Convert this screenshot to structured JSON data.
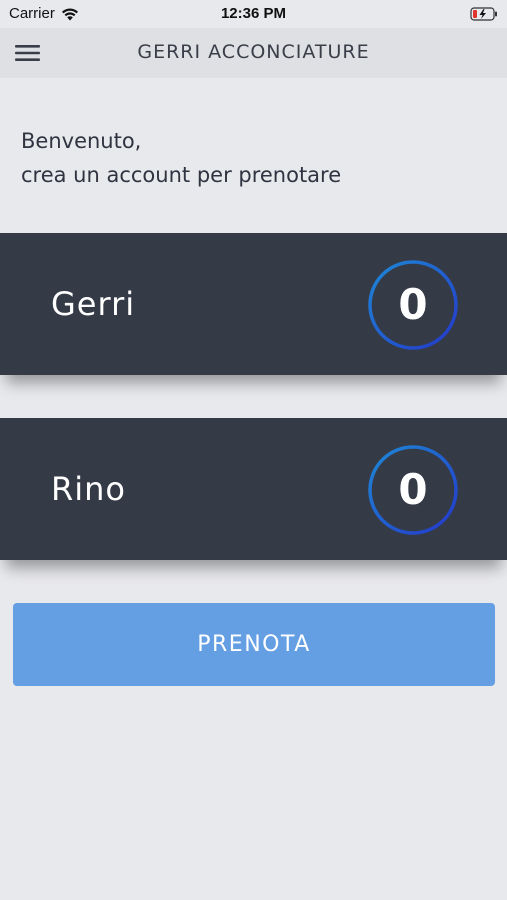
{
  "status_bar": {
    "carrier": "Carrier",
    "time": "12:36 PM",
    "icons": [
      "wifi-icon",
      "battery-charging-icon"
    ]
  },
  "header": {
    "title": "GERRI ACCONCIATURE",
    "menu_icon": "hamburger-menu-icon"
  },
  "welcome": {
    "line1": "Benvenuto,",
    "line2": "crea un account per prenotare"
  },
  "barbers": [
    {
      "name": "Gerri",
      "count": "0"
    },
    {
      "name": "Rino",
      "count": "0"
    }
  ],
  "actions": {
    "book_label": "PRENOTA"
  },
  "colors": {
    "background": "#e8e9ed",
    "card": "#343a46",
    "ring_gradient": [
      "#1e88d6",
      "#2438c9"
    ],
    "button": "#649fe4"
  }
}
